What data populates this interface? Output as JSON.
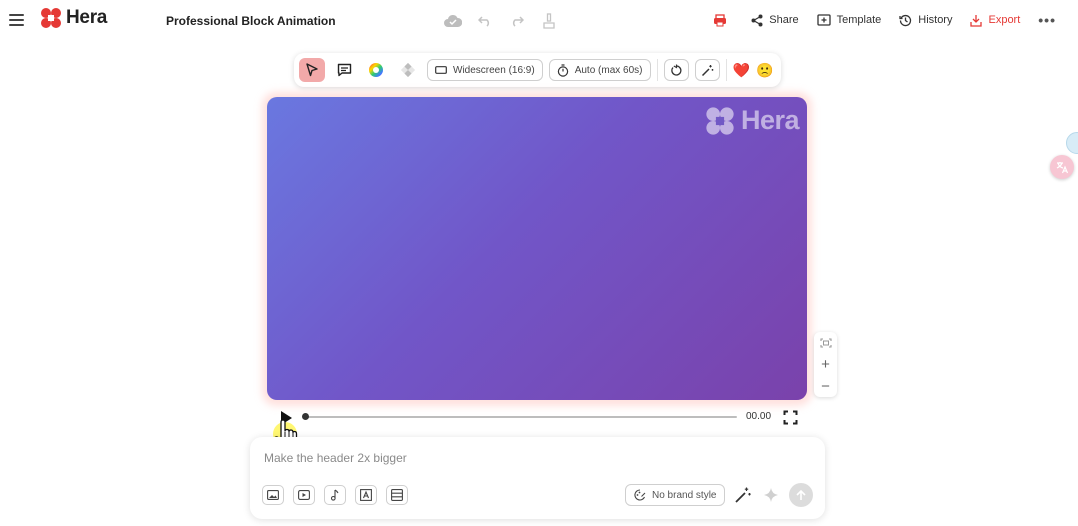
{
  "app": {
    "name": "Hera",
    "document_title": "Professional Block Animation",
    "brand_color": "#e53935"
  },
  "header": {
    "actions": [
      {
        "icon": "printer-icon",
        "label": ""
      },
      {
        "icon": "share-icon",
        "label": "Share"
      },
      {
        "icon": "template-icon",
        "label": "Template"
      },
      {
        "icon": "history-icon",
        "label": "History"
      },
      {
        "icon": "download-icon",
        "label": "Export"
      }
    ],
    "more": "•••"
  },
  "toolbar": {
    "aspect_label": "Widescreen (16:9)",
    "duration_label": "Auto (max 60s)",
    "emojis": [
      "❤️",
      "🙁"
    ]
  },
  "canvas": {
    "watermark": "Hera",
    "gradient_start": "#6a78e0",
    "gradient_end": "#7a42ab"
  },
  "player": {
    "timecode": "00.00",
    "progress": 0
  },
  "zoom": {
    "plus": "+",
    "minus": "−"
  },
  "prompt": {
    "placeholder": "Make the header 2x bigger",
    "brand_style_label": "No brand style"
  }
}
